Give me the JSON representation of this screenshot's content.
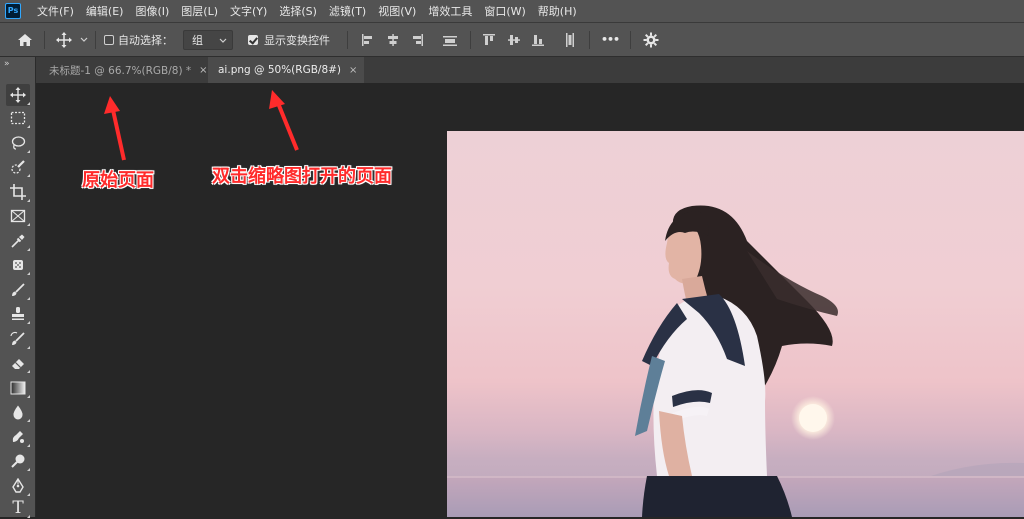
{
  "app": {
    "logo": "Ps"
  },
  "menu": [
    "文件(F)",
    "编辑(E)",
    "图像(I)",
    "图层(L)",
    "文字(Y)",
    "选择(S)",
    "滤镜(T)",
    "视图(V)",
    "增效工具",
    "窗口(W)",
    "帮助(H)"
  ],
  "options": {
    "auto_select_label": "自动选择：",
    "auto_select_checked": false,
    "group_value": "组",
    "show_transform_label": "显示变换控件",
    "show_transform_checked": true,
    "more_label": "•••"
  },
  "tabs": [
    {
      "label": "未标题-1 @ 66.7%(RGB/8) *",
      "close": "×",
      "active": false
    },
    {
      "label": "ai.png @ 50%(RGB/8#)",
      "close": "×",
      "active": true
    }
  ],
  "toolbar": {
    "collapse": "»",
    "tools": [
      "move-icon",
      "marquee-icon",
      "lasso-icon",
      "quick-select-icon",
      "crop-icon",
      "frame-icon",
      "eyedropper-icon",
      "spot-healing-icon",
      "brush-icon",
      "clone-stamp-icon",
      "history-brush-icon",
      "eraser-icon",
      "gradient-icon",
      "blur-icon",
      "smudge-icon",
      "dodge-icon",
      "pen-icon",
      "type-icon"
    ],
    "type_glyph": "T"
  },
  "annotations": {
    "original": "原始页面",
    "opened": "双击缩略图打开的页面"
  },
  "colors": {
    "annotation": "#ff2b2b",
    "panel": "#535353",
    "canvas": "#262626"
  }
}
